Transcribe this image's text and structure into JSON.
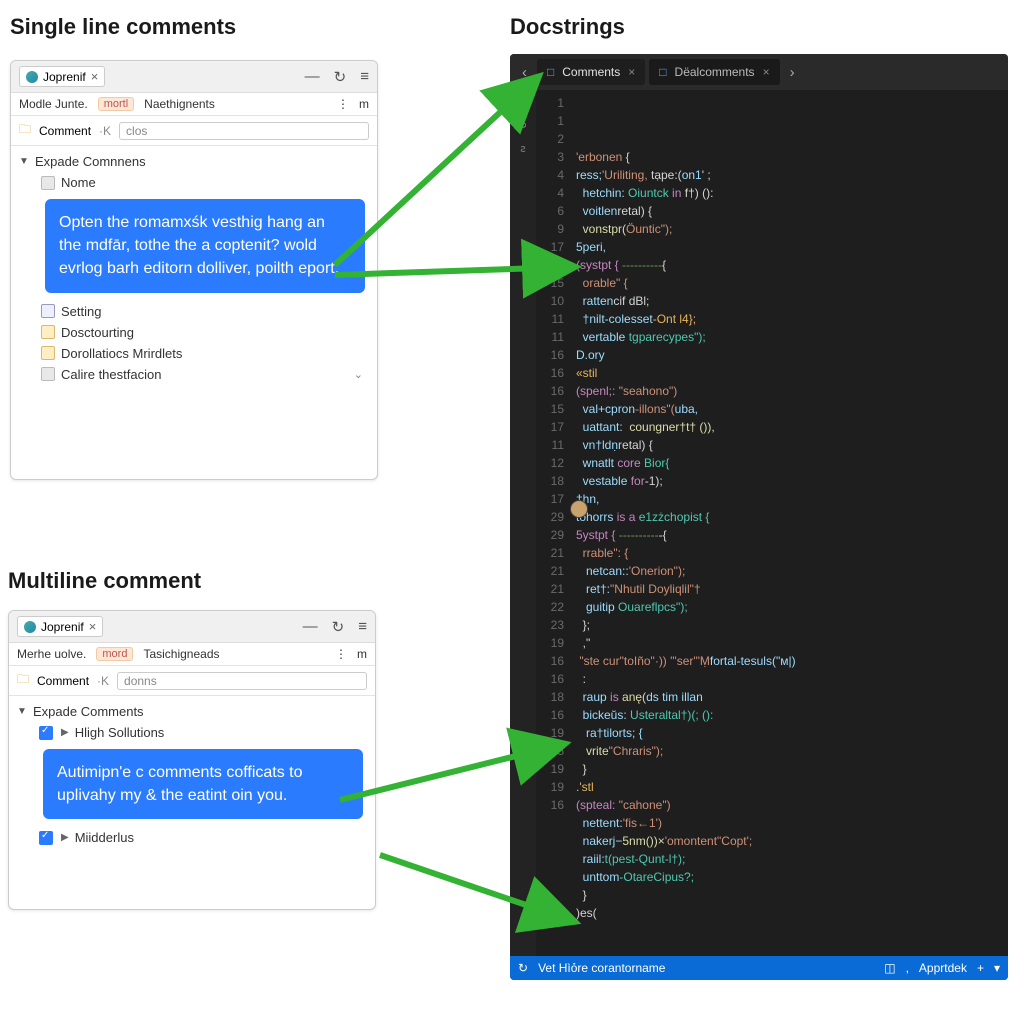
{
  "titles": {
    "single": "Single line comments",
    "multi": "Multiline comment",
    "doc": "Docstrings"
  },
  "panel1": {
    "tab": "Joprenif",
    "crumb1": "Modle Junte.",
    "crumb_badge": "mortl",
    "crumb2": "Naethignents",
    "more": "⋮",
    "m": "m",
    "comment_btn": "Comment",
    "search_ph": "clos",
    "tree_header": "Expade Comnnens",
    "item_name": "Nome",
    "callout": "Opten the romamxśk vesthig hang an the mdfār, tothe the a coptenit? wold evrlog barh editorn dolliver, poilth eport.",
    "items": [
      "Setting",
      "Dosctourting",
      "Dorollatiocs Mrirdlets",
      "Calire thestfacion"
    ]
  },
  "panel2": {
    "tab": "Joprenif",
    "crumb1": "Merhe uolve.",
    "crumb_badge": "mord",
    "crumb2": "Tasichigneads",
    "more": "⋮",
    "m": "m",
    "comment_btn": "Comment",
    "search_ph": "donns",
    "tree_header": "Expade Comments",
    "item1": "Hligh Sollutions",
    "callout": "Autimipn'e c comments cofficats to uplivahy my & the eatint oin you.",
    "item2": "Miidderlus"
  },
  "editor": {
    "tabs": [
      {
        "icon": "□",
        "label": "Comments"
      },
      {
        "icon": "□",
        "label": "Dëalcomments"
      }
    ],
    "nav_back": "‹",
    "nav_fwd": "›",
    "activity_label": "Cooo",
    "activity2": "ꙅ",
    "gutter": [
      "1",
      "1",
      "2",
      "3",
      "4",
      "4",
      "6",
      "9",
      "17",
      "19",
      "15",
      "10",
      "11",
      "11",
      "16",
      "16",
      "16",
      "15",
      "17",
      "11",
      "12",
      "18",
      "17",
      "29",
      "29",
      "21",
      "21",
      "21",
      "",
      "22",
      "23",
      "19",
      "16",
      "16",
      "18",
      "16",
      "19",
      "15",
      "19",
      "19",
      "16"
    ],
    "code_lines": [
      [
        {
          "t": "'erbonen",
          "c": "str"
        },
        {
          "t": " {",
          "c": "pu"
        }
      ],
      [
        {
          "t": "ress;",
          "c": "id"
        },
        {
          "t": "'Uriliting,",
          "c": "str"
        },
        {
          "t": " tạpe:(",
          "c": "pu"
        },
        {
          "t": "on1",
          "c": "id"
        },
        {
          "t": "' ;",
          "c": "pu"
        }
      ],
      [
        {
          "t": "  hetchin: ",
          "c": "id"
        },
        {
          "t": "Oiuntck",
          "c": "ty"
        },
        {
          "t": " in ",
          "c": "kw"
        },
        {
          "t": "f†) ():",
          "c": "pu"
        }
      ],
      [
        {
          "t": "  voitlen",
          "c": "id"
        },
        {
          "t": "retal) {",
          "c": "pu"
        }
      ],
      [
        {
          "t": "  vonstpr(",
          "c": "fn"
        },
        {
          "t": "Öuntic\");",
          "c": "str"
        }
      ],
      [
        {
          "t": "5peri,",
          "c": "id"
        }
      ],
      [
        {
          "t": "",
          "c": "pu"
        }
      ],
      [
        {
          "t": "(systpt { ",
          "c": "kw"
        },
        {
          "t": "----------",
          "c": "cm"
        },
        {
          "t": "{",
          "c": "pu"
        }
      ],
      [
        {
          "t": "  orable\" {",
          "c": "str"
        }
      ],
      [
        {
          "t": "  ratten",
          "c": "id"
        },
        {
          "t": "cif dBl;",
          "c": "pu"
        }
      ],
      [
        {
          "t": "  †nilt-colesset",
          "c": "id"
        },
        {
          "t": "-Ont l4};",
          "c": "op"
        }
      ],
      [
        {
          "t": "  vertable ",
          "c": "id"
        },
        {
          "t": "tgparecypes\");",
          "c": "ty"
        }
      ],
      [
        {
          "t": "D.ory",
          "c": "id"
        }
      ],
      [
        {
          "t": "«stil",
          "c": "op"
        }
      ],
      [
        {
          "t": "",
          "c": "pu"
        }
      ],
      [
        {
          "t": "(spenl;: ",
          "c": "kw"
        },
        {
          "t": "\"seahono\")",
          "c": "str"
        }
      ],
      [
        {
          "t": "  val+cpron",
          "c": "id"
        },
        {
          "t": "-illons\"(",
          "c": "str"
        },
        {
          "t": "uba,",
          "c": "id"
        }
      ],
      [
        {
          "t": "  uattant:  ",
          "c": "id"
        },
        {
          "t": "coungner†t† ()),",
          "c": "fn"
        }
      ],
      [
        {
          "t": "  vn†ldṇr",
          "c": "id"
        },
        {
          "t": "etal) {",
          "c": "pu"
        }
      ],
      [
        {
          "t": "  wnatlt ",
          "c": "id"
        },
        {
          "t": "core ",
          "c": "kw"
        },
        {
          "t": "Bior{",
          "c": "ty"
        }
      ],
      [
        {
          "t": "  vestable ",
          "c": "id"
        },
        {
          "t": "for",
          "c": "kw"
        },
        {
          "t": "-1);",
          "c": "pu"
        }
      ],
      [
        {
          "t": "†hn,",
          "c": "id"
        }
      ],
      [
        {
          "t": "tohorrs ",
          "c": "id"
        },
        {
          "t": "is a ",
          "c": "kw"
        },
        {
          "t": "e1zżchopist {",
          "c": "ty"
        }
      ],
      [
        {
          "t": "",
          "c": "pu"
        }
      ],
      [
        {
          "t": "5ystpt { ",
          "c": "kw"
        },
        {
          "t": "----------",
          "c": "cm"
        },
        {
          "t": "-{",
          "c": "pu"
        }
      ],
      [
        {
          "t": "  rrable\": {",
          "c": "str"
        }
      ],
      [
        {
          "t": "   netcan::",
          "c": "id"
        },
        {
          "t": "'Onerion\");",
          "c": "str"
        }
      ],
      [
        {
          "t": "   ret†:",
          "c": "id"
        },
        {
          "t": "\"Nhutil Doyliqlil\"†",
          "c": "str"
        }
      ],
      [
        {
          "t": "   guitip ",
          "c": "id"
        },
        {
          "t": "Ouareflpcs\");",
          "c": "ty"
        }
      ],
      [
        {
          "t": "  };",
          "c": "pu"
        }
      ],
      [
        {
          "t": "  ,\"",
          "c": "pu"
        }
      ],
      [
        {
          "t": " \"ste cur",
          "c": "str"
        },
        {
          "t": "\"toIño\"·)) '\"ser'\"Ṃ",
          "c": "str"
        },
        {
          "t": "fortal-tesuls(\"м|)",
          "c": "id"
        }
      ],
      [
        {
          "t": "  :",
          "c": "pu"
        }
      ],
      [
        {
          "t": "  raup ",
          "c": "id"
        },
        {
          "t": "is ",
          "c": "kw"
        },
        {
          "t": "anę(",
          "c": "fn"
        },
        {
          "t": "ds tim illan",
          "c": "id"
        }
      ],
      [
        {
          "t": "  bickeŭs: ",
          "c": "id"
        },
        {
          "t": "Usteraltal†)(; ():",
          "c": "ty"
        }
      ],
      [
        {
          "t": "   ra†tilorts; {",
          "c": "id"
        }
      ],
      [
        {
          "t": "   vrite",
          "c": "fn"
        },
        {
          "t": "\"Chraris\");",
          "c": "str"
        }
      ],
      [
        {
          "t": "  }",
          "c": "pu"
        }
      ],
      [
        {
          "t": ".'stl",
          "c": "op"
        }
      ],
      [
        {
          "t": "",
          "c": "pu"
        }
      ],
      [
        {
          "t": "(spteal: ",
          "c": "kw"
        },
        {
          "t": "\"cahone\")",
          "c": "str"
        }
      ],
      [
        {
          "t": "  nettent:",
          "c": "id"
        },
        {
          "t": "'fis←1')",
          "c": "str"
        }
      ],
      [
        {
          "t": "  nakerj−",
          "c": "id"
        },
        {
          "t": "5nm())×",
          "c": "fn"
        },
        {
          "t": "'omontent\"Copt';",
          "c": "str"
        }
      ],
      [
        {
          "t": "  raiil:",
          "c": "id"
        },
        {
          "t": "t(pest-Qunt-l†);",
          "c": "ty"
        }
      ],
      [
        {
          "t": "  unttom",
          "c": "id"
        },
        {
          "t": "-OtareCipus?;",
          "c": "ty"
        }
      ],
      [
        {
          "t": "  }",
          "c": "pu"
        }
      ],
      [
        {
          "t": ")es(",
          "c": "pu"
        }
      ]
    ],
    "status": {
      "left_icon": "↻",
      "left": "Vet Hìỏre corantorname",
      "right1": "◫",
      "right2": "Apprtdek",
      "plus": "+",
      "chev": "▾"
    }
  }
}
